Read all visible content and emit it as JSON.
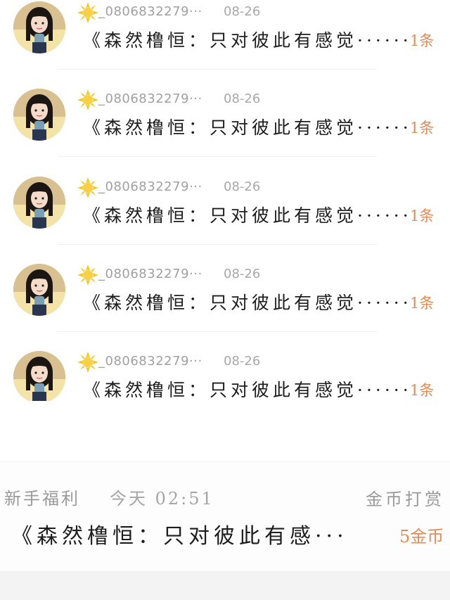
{
  "colors": {
    "accent_orange": "#e38b55",
    "muted_text": "#a0a0a0",
    "primary_text": "#1d1d1d",
    "sun_yellow": "#f5c518"
  },
  "list": {
    "items": [
      {
        "avatar_icon": "girl-avatar",
        "badge_icon": "sun-icon",
        "username": "_0806832279···",
        "date": "08-26",
        "title": "《森然橹恒：只对彼此有感觉······",
        "count": "1条"
      },
      {
        "avatar_icon": "girl-avatar",
        "badge_icon": "sun-icon",
        "username": "_0806832279···",
        "date": "08-26",
        "title": "《森然橹恒：只对彼此有感觉······",
        "count": "1条"
      },
      {
        "avatar_icon": "girl-avatar",
        "badge_icon": "sun-icon",
        "username": "_0806832279···",
        "date": "08-26",
        "title": "《森然橹恒：只对彼此有感觉······",
        "count": "1条"
      },
      {
        "avatar_icon": "girl-avatar",
        "badge_icon": "sun-icon",
        "username": "_0806832279···",
        "date": "08-26",
        "title": "《森然橹恒：只对彼此有感觉······",
        "count": "1条"
      },
      {
        "avatar_icon": "girl-avatar",
        "badge_icon": "sun-icon",
        "username": "_0806832279···",
        "date": "08-26",
        "title": "《森然橹恒：只对彼此有感觉······",
        "count": "1条"
      }
    ]
  },
  "bottom_card": {
    "label": "新手福利",
    "time": "今天 02:51",
    "right_label": "金币打赏",
    "title": "《森然橹恒：只对彼此有感···",
    "amount": "5金币"
  }
}
